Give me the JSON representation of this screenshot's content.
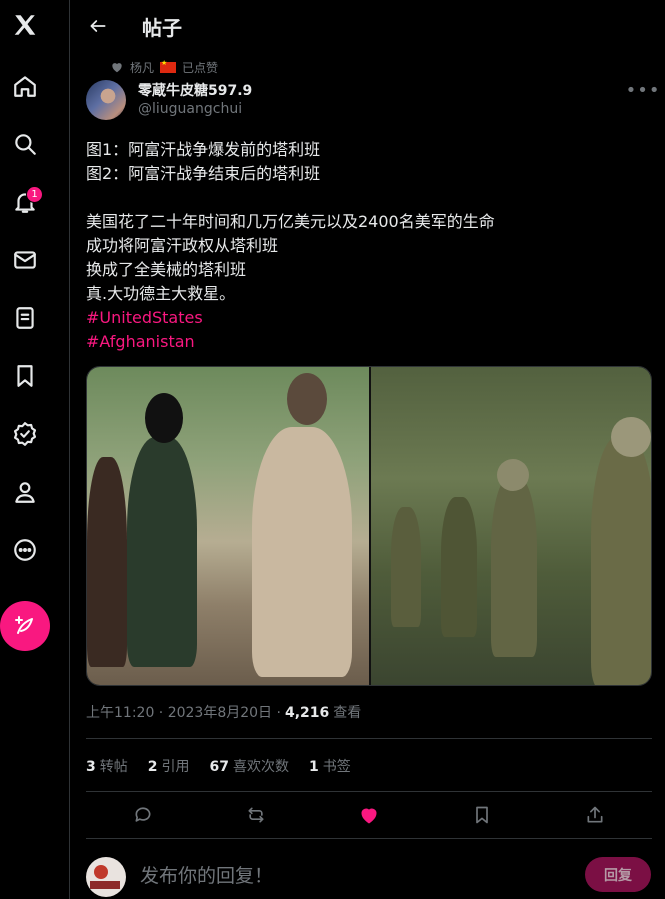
{
  "header": {
    "title": "帖子"
  },
  "sidebar": {
    "items": [
      {
        "icon": "home-icon"
      },
      {
        "icon": "search-icon"
      },
      {
        "icon": "notifications-icon",
        "badge": "1"
      },
      {
        "icon": "messages-icon"
      },
      {
        "icon": "lists-icon"
      },
      {
        "icon": "bookmarks-icon"
      },
      {
        "icon": "verified-icon"
      },
      {
        "icon": "profile-icon"
      },
      {
        "icon": "more-icon"
      }
    ],
    "compose_icon": "compose-post-icon"
  },
  "liked_by": {
    "name": "杨凡",
    "text": "已点赞"
  },
  "author": {
    "display_name": "零蔵牛皮糖597.9",
    "handle": "@liuguangchui"
  },
  "tweet": {
    "lines": [
      "图1：阿富汗战争爆发前的塔利班",
      "图2：阿富汗战争结束后的塔利班",
      "",
      "美国花了二十年时间和几万亿美元以及2400名美军的生命",
      "成功将阿富汗政权从塔利班",
      "换成了全美械的塔利班",
      "真.大功德主大救星。"
    ],
    "hashtags": [
      "#UnitedStates",
      "#Afghanistan"
    ]
  },
  "meta": {
    "time": "上午11:20 · 2023年8月20日 ·",
    "views": "4,216",
    "views_label": "查看"
  },
  "stats": {
    "retweets": "3",
    "retweets_label": "转帖",
    "quotes": "2",
    "quotes_label": "引用",
    "likes": "67",
    "likes_label": "喜欢次数",
    "bookmarks": "1",
    "bookmarks_label": "书签"
  },
  "reply": {
    "placeholder": "发布你的回复！",
    "button": "回复"
  },
  "colors": {
    "accent": "#f91880",
    "muted": "#71767b",
    "border": "#2f3336",
    "text": "#e7e9ea",
    "background": "#000000"
  }
}
